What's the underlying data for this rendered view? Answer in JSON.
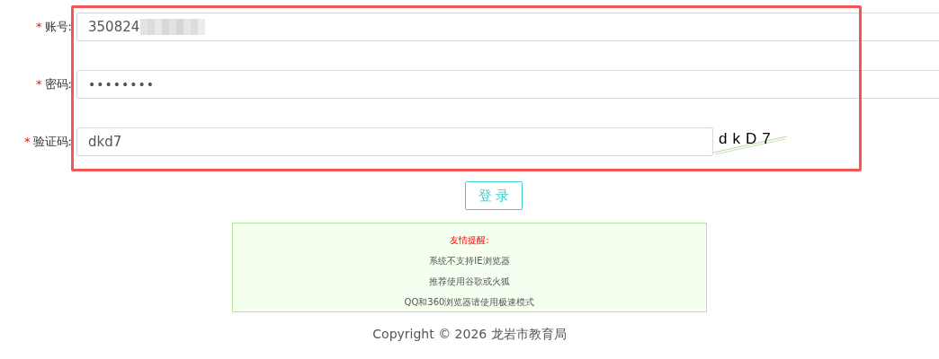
{
  "fields": [
    {
      "kind": "text",
      "marker": "*",
      "label": "账号:",
      "value": "350824",
      "redacted": true
    },
    {
      "kind": "password",
      "marker": "*",
      "label": "密码:",
      "value": "••••••••"
    },
    {
      "kind": "captcha",
      "marker": "*",
      "label": "验证码:",
      "value": "dkd7",
      "captcha": "dkD7"
    }
  ],
  "login_button": "登 录",
  "notice": {
    "title": "友情提醒:",
    "lines": [
      "系统不支持IE浏览器",
      "推荐使用谷歌或火狐",
      "QQ和360浏览器请使用极速模式"
    ]
  },
  "footer": "Copyright © 2026 龙岩市教育局"
}
